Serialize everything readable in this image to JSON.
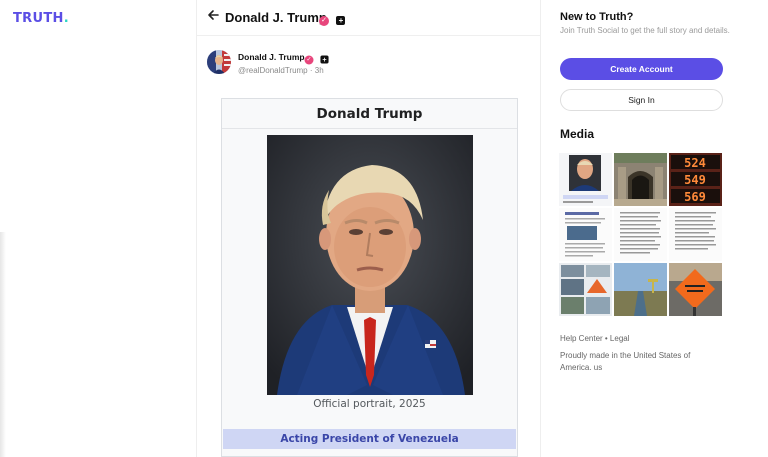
{
  "brand": {
    "logo_text": "TRUTH",
    "logo_dot": ".",
    "accent": "#5b4ee5",
    "dot_color": "#2ad6c6"
  },
  "topbar": {
    "back_icon": "arrow-left-icon",
    "title": "Donald J. Trump",
    "verified_glyph": "✓",
    "plus_glyph": "+"
  },
  "post": {
    "author_name": "Donald J. Trump",
    "handle": "@realDonaldTrump",
    "separator": "·",
    "time": "3h"
  },
  "infobox": {
    "title": "Donald Trump",
    "caption": "Official portrait, 2025",
    "role": "Acting President of Venezuela"
  },
  "sidebar": {
    "heading": "New to Truth?",
    "subtext": "Join Truth Social to get the full story and details.",
    "create_label": "Create Account",
    "signin_label": "Sign In",
    "media_heading": "Media",
    "footer_links": "Help Center • Legal",
    "made_in": "Proudly made in the United States of America. us"
  },
  "media_thumbs": [
    {
      "label": "",
      "kind": "document-portrait"
    },
    {
      "label": "",
      "kind": "building-entrance"
    },
    {
      "label": "524 549 569",
      "kind": "gas-price-sign"
    },
    {
      "label": "",
      "kind": "text-document"
    },
    {
      "label": "",
      "kind": "text-document"
    },
    {
      "label": "",
      "kind": "text-document"
    },
    {
      "label": "",
      "kind": "flood-collage"
    },
    {
      "label": "",
      "kind": "canal-landscape"
    },
    {
      "label": "",
      "kind": "road-sign"
    }
  ]
}
